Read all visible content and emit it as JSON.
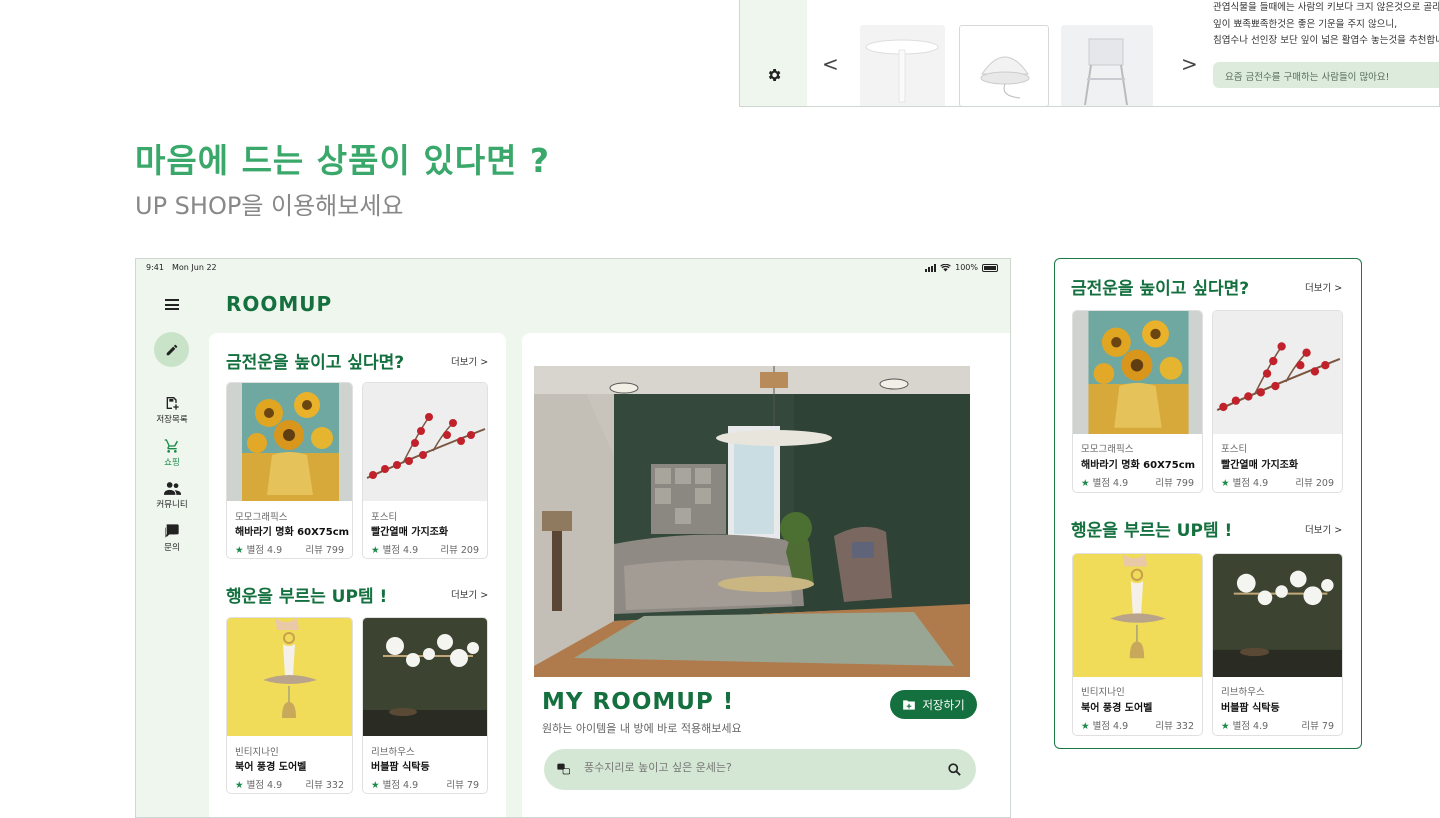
{
  "top_panel": {
    "nav_prev": "<",
    "nav_next": ">",
    "tip_lines": [
      "관엽식물을 들때에는 사람의 키보다 크지 않은것으로 골라야",
      "잎이 뾰족뾰족한것은 좋은 기운을 주지 않으니,",
      "침엽수나 선인장 보단 잎이 넓은 활엽수 놓는것을 추천합니"
    ],
    "tip_box": "요즘 금전수를 구매하는 사람들이 많아요!"
  },
  "headline": "마음에 드는 상품이 있다면 ?",
  "subline": "UP SHOP을 이용해보세요",
  "status": {
    "time": "9:41",
    "date": "Mon Jun 22",
    "battery": "100%"
  },
  "app": {
    "logo": "ROOMUP",
    "nav": [
      {
        "label": "저장목록",
        "icon": "save-list-icon"
      },
      {
        "label": "쇼핑",
        "icon": "cart-icon"
      },
      {
        "label": "커뮤니티",
        "icon": "people-icon"
      },
      {
        "label": "문의",
        "icon": "chat-icon"
      }
    ]
  },
  "sections": {
    "money": {
      "title": "금전운을 높이고 싶다면?",
      "more": "더보기 >"
    },
    "luck": {
      "title": "행운을 부르는 UP템 !",
      "more": "더보기 >"
    }
  },
  "products": [
    {
      "brand": "모모그래픽스",
      "name": "해바라기 명화 60X75cm",
      "rating": "별점 4.9",
      "review": "리뷰 799"
    },
    {
      "brand": "포스티",
      "name": "빨간열매 가지조화",
      "rating": "별점 4.9",
      "review": "리뷰 209"
    },
    {
      "brand": "빈티지나인",
      "name": "북어 풍경 도어벨",
      "rating": "별점 4.9",
      "review": "리뷰 332"
    },
    {
      "brand": "리브하우스",
      "name": "버블팜 식탁등",
      "rating": "별점 4.9",
      "review": "리뷰 79"
    }
  ],
  "myroom": {
    "title": "MY ROOMUP !",
    "subtitle": "원하는 아이템을 내 방에 바로 적용해보세요",
    "save_label": "저장하기",
    "search_placeholder": "풍수지리로 높이고 싶은 운세는?"
  },
  "colors": {
    "brand": "#14703e",
    "accent": "#3aa86a",
    "panel": "#eef6ee"
  }
}
